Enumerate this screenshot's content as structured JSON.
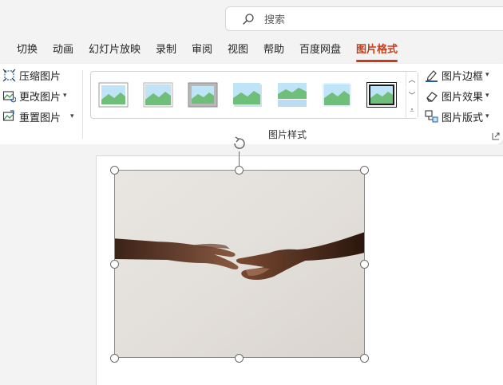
{
  "search": {
    "placeholder": "搜索"
  },
  "tabs": [
    {
      "label": "切换"
    },
    {
      "label": "动画"
    },
    {
      "label": "幻灯片放映"
    },
    {
      "label": "录制"
    },
    {
      "label": "审阅"
    },
    {
      "label": "视图"
    },
    {
      "label": "帮助"
    },
    {
      "label": "百度网盘"
    },
    {
      "label": "图片格式",
      "active": true
    }
  ],
  "adjust": {
    "compress_label": "压缩图片",
    "change_label": "更改图片",
    "reset_label": "重置图片"
  },
  "picture_styles": {
    "group_label": "图片样式",
    "thumbnail_count": 7
  },
  "style_options": {
    "border_label": "图片边框",
    "effects_label": "图片效果",
    "layout_label": "图片版式"
  },
  "colors": {
    "accent": "#c43e1c",
    "ribbon_bg": "#ffffff",
    "app_bg": "#f3f3f3"
  }
}
